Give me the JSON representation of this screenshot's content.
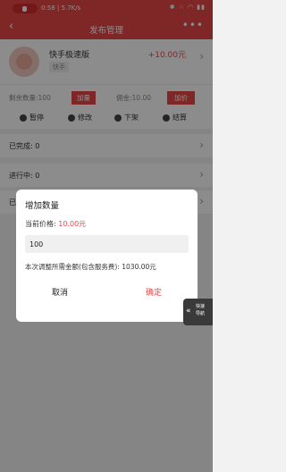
{
  "status_bar": {
    "time_speed": "0:58 | 5.7K/s",
    "icons": "✱ ⁙ ◠ ▮▮"
  },
  "nav": {
    "back": "‹",
    "title": "发布管理",
    "more": "•••"
  },
  "product": {
    "name": "快手极速版",
    "platform_tag": "快手",
    "price": "+10.00元",
    "remaining": "剩余数量:100",
    "add_button": "加量",
    "fee": "佣金:10.00",
    "raise_button": "加价"
  },
  "actions": [
    {
      "label": "暂停",
      "icon": "pause-icon"
    },
    {
      "label": "修改",
      "icon": "edit-icon"
    },
    {
      "label": "下架",
      "icon": "shelf-icon"
    },
    {
      "label": "结算",
      "icon": "settle-icon"
    }
  ],
  "rows": [
    {
      "label": "已完成: 0"
    },
    {
      "label": "进行中: 0"
    },
    {
      "label": "已"
    }
  ],
  "dialog": {
    "title": "增加数量",
    "price_label": "当前价格: ",
    "price_value": "10.00元",
    "quantity_value": "100",
    "total_text": "本次调整所需金额(包含服务费): 1030.00元",
    "cancel": "取消",
    "confirm": "确定"
  },
  "quick_nav": {
    "arrow": "«",
    "label": "快速导航"
  },
  "colors": {
    "accent": "#e84848",
    "overlay": "rgba(0,0,0,0.45)"
  }
}
